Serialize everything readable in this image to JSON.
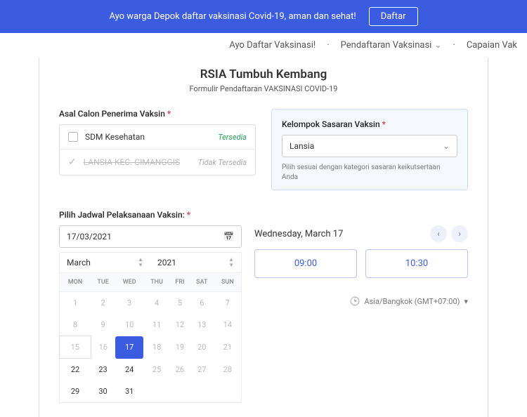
{
  "banner": {
    "text": "Ayo warga Depok daftar vaksinasi Covid-19, aman dan sehat!",
    "cta": "Daftar"
  },
  "nav": {
    "item1": "Ayo Daftar Vaksinasi!",
    "item2": "Pendaftaran Vaksinasi",
    "item3": "Capaian Vak"
  },
  "header": {
    "title": "RSIA Tumbuh Kembang",
    "subtitle": "Formulir Pendaftaran VAKSINASI COVID-19"
  },
  "origin": {
    "label": "Asal Calon Penerima Vaksin",
    "opt1_name": "SDM Kesehatan",
    "opt1_status": "Tersedia",
    "opt2_name": "LANSIA KEC. CIMANGGIS",
    "opt2_status": "Tidak Tersedia"
  },
  "group": {
    "label": "Kelompok Sasaran Vaksin",
    "selected": "Lansia",
    "hint": "Pilih sesuai dengan kategori sasaran keikutsertaan Anda"
  },
  "schedule": {
    "label": "Pilih Jadwal Pelaksanaan Vaksin:",
    "date_value": "17/03/2021",
    "month": "March",
    "year": "2021",
    "dow": [
      "MON",
      "TUE",
      "WED",
      "THU",
      "FRI",
      "SAT",
      "SUN"
    ],
    "weeks": [
      [
        {
          "d": "1"
        },
        {
          "d": "2"
        },
        {
          "d": "3"
        },
        {
          "d": "4"
        },
        {
          "d": "5"
        },
        {
          "d": "6"
        },
        {
          "d": "7"
        }
      ],
      [
        {
          "d": "8"
        },
        {
          "d": "9"
        },
        {
          "d": "10"
        },
        {
          "d": "11"
        },
        {
          "d": "12"
        },
        {
          "d": "13"
        },
        {
          "d": "14"
        }
      ],
      [
        {
          "d": "15",
          "box": true
        },
        {
          "d": "16"
        },
        {
          "d": "17",
          "sel": true
        },
        {
          "d": "18"
        },
        {
          "d": "19"
        },
        {
          "d": "20"
        },
        {
          "d": "21"
        }
      ],
      [
        {
          "d": "22",
          "cur": true
        },
        {
          "d": "23",
          "cur": true
        },
        {
          "d": "24",
          "cur": true
        },
        {
          "d": "25"
        },
        {
          "d": "26"
        },
        {
          "d": "27"
        },
        {
          "d": "28"
        }
      ],
      [
        {
          "d": "29",
          "cur": true
        },
        {
          "d": "30",
          "cur": true
        },
        {
          "d": "31",
          "cur": true
        },
        {
          "d": ""
        },
        {
          "d": ""
        },
        {
          "d": ""
        },
        {
          "d": ""
        }
      ]
    ],
    "selected_day_label": "Wednesday, March 17",
    "slot1": "09:00",
    "slot2": "10:30",
    "tz": "Asia/Bangkok (GMT+07:00)"
  },
  "asterisk": "*"
}
